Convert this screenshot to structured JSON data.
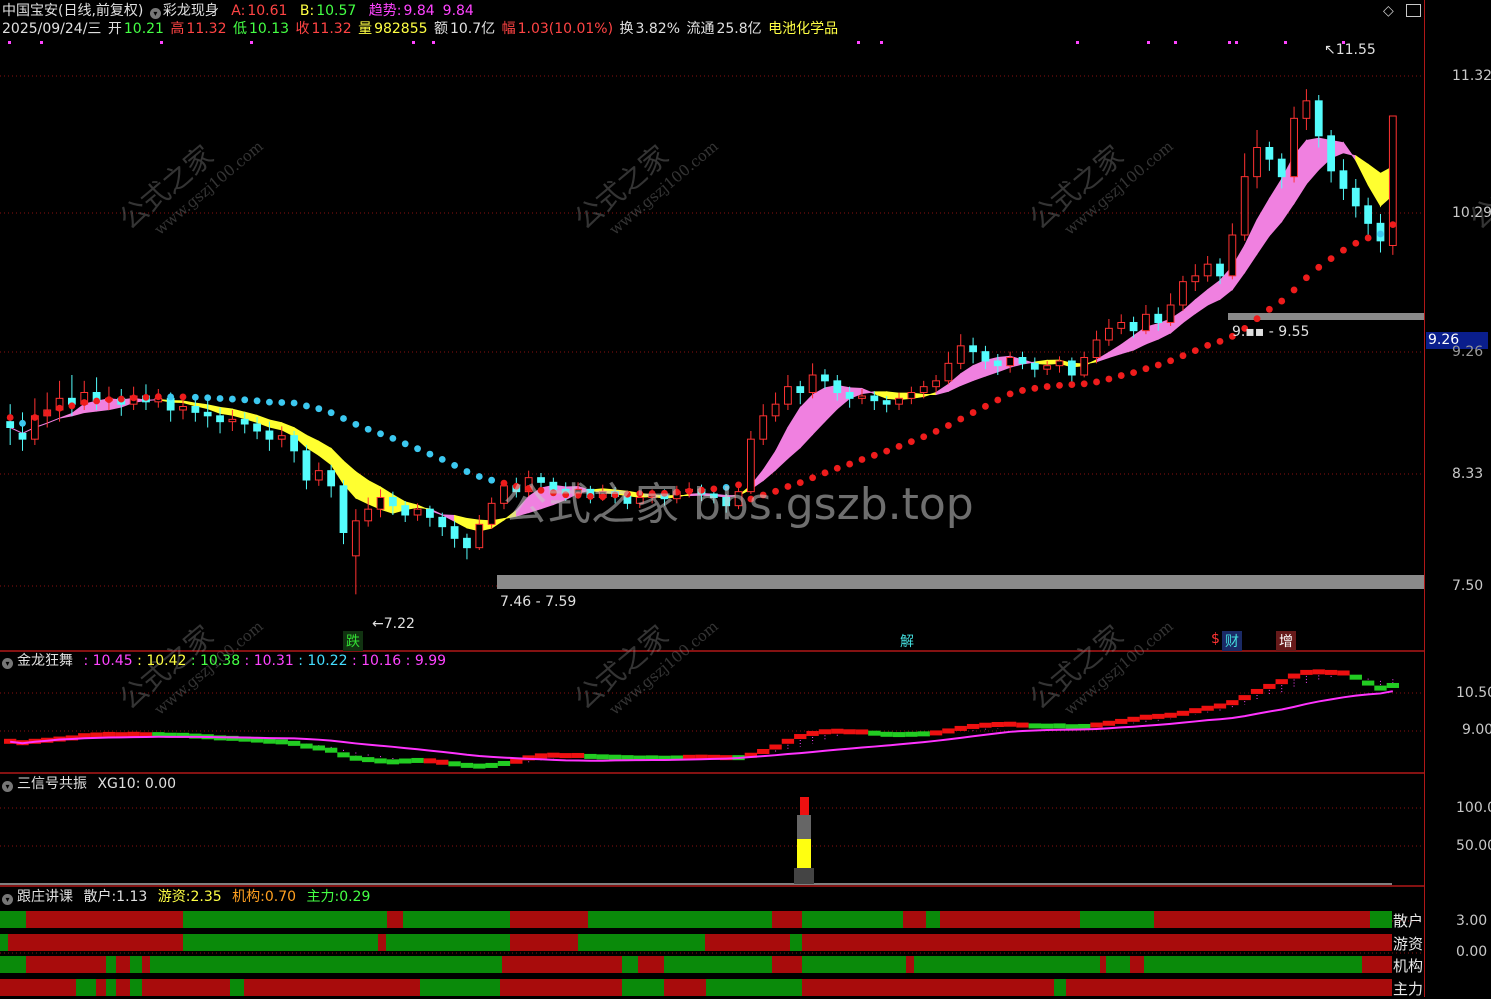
{
  "header": {
    "stock_name": "中国宝安(日线,前复权)",
    "indicator_name": "彩龙现身",
    "a_label": "A:",
    "a_value": "10.61",
    "b_label": "B:",
    "b_value": "10.57",
    "trend_label": "趋势:",
    "trend_value1": "9.84",
    "trend_value2": "9.84",
    "date": "2025/09/24/三",
    "open_label": "开",
    "open_value": "10.21",
    "high_label": "高",
    "high_value": "11.32",
    "low_label": "低",
    "low_value": "10.13",
    "close_label": "收",
    "close_value": "11.32",
    "volume_label": "量",
    "volume_value": "982855",
    "amount_label": "额",
    "amount_value": "10.7亿",
    "range_label": "幅",
    "range_value": "1.03(10.01%)",
    "turnover_label": "换",
    "turnover_value": "3.82%",
    "float_label": "流通",
    "float_value": "25.8亿",
    "sector": "电池化学品"
  },
  "main_chart": {
    "price_axis": [
      "11.32",
      "10.29",
      "9.26",
      "8.33",
      "7.50"
    ],
    "current_price_tag": "9.26",
    "annotations": {
      "high_mark": "11.55",
      "low_mark": "7.22",
      "zone_low": "7.46 - 7.59",
      "zone_high": "9.55",
      "zone_high_prefix": "9."
    },
    "signals": [
      {
        "text": "跌",
        "color": "#33dd33"
      },
      {
        "text": "解",
        "color": "#44dddd"
      },
      {
        "text": "$",
        "color": "#ff3333"
      },
      {
        "text": "财",
        "color": "#44dddd"
      },
      {
        "text": "增",
        "color": "#ffffff"
      }
    ],
    "watermark": "公式之家 bbs.gszb.top",
    "watermark_small_cn": "公式之家",
    "watermark_small_url": "www.gszj100.com"
  },
  "panel2": {
    "title": "金龙狂舞",
    "values": [
      {
        "text": "10.45",
        "color": "#ff44ff"
      },
      {
        "text": "10.42",
        "color": "#ffff44"
      },
      {
        "text": "10.38",
        "color": "#44ff44"
      },
      {
        "text": "10.31",
        "color": "#ff44ff"
      },
      {
        "text": "10.22",
        "color": "#44ddff"
      },
      {
        "text": "10.16",
        "color": "#ff44ff"
      },
      {
        "text": "9.99",
        "color": "#ff44ff"
      }
    ],
    "axis": [
      "10.50",
      "9.00"
    ]
  },
  "panel3": {
    "title": "三信号共振",
    "label": "XG10:",
    "value": "0.00",
    "axis": [
      "100.0",
      "50.00"
    ]
  },
  "panel4": {
    "title": "跟庄讲课",
    "items": [
      {
        "label": "散户:",
        "value": "1.13",
        "color": "#e0e0e0"
      },
      {
        "label": "游资:",
        "value": "2.35",
        "color": "#ffff44"
      },
      {
        "label": "机构:",
        "value": "0.70",
        "color": "#ffa020"
      },
      {
        "label": "主力:",
        "value": "0.29",
        "color": "#44ff44"
      }
    ],
    "axis": [
      "3.00",
      "0.00"
    ],
    "row_labels": [
      "散户",
      "游资",
      "机构",
      "主力"
    ]
  },
  "chart_data": {
    "type": "candlestick",
    "price_range": [
      7.0,
      11.8
    ],
    "candles": [
      [
        8.7,
        8.65,
        8.85,
        8.5
      ],
      [
        8.6,
        8.55,
        8.78,
        8.45
      ],
      [
        8.55,
        8.75,
        8.9,
        8.5
      ],
      [
        8.75,
        8.8,
        8.95,
        8.65
      ],
      [
        8.8,
        8.9,
        9.05,
        8.7
      ],
      [
        8.9,
        8.85,
        9.1,
        8.75
      ],
      [
        8.85,
        8.95,
        9.05,
        8.8
      ],
      [
        8.95,
        8.88,
        9.08,
        8.8
      ],
      [
        8.88,
        8.9,
        9.0,
        8.8
      ],
      [
        8.9,
        8.85,
        8.98,
        8.75
      ],
      [
        8.85,
        8.92,
        9.0,
        8.8
      ],
      [
        8.92,
        8.87,
        9.02,
        8.8
      ],
      [
        8.87,
        8.9,
        8.98,
        8.82
      ],
      [
        8.9,
        8.8,
        8.95,
        8.7
      ],
      [
        8.8,
        8.83,
        8.9,
        8.72
      ],
      [
        8.83,
        8.78,
        8.92,
        8.7
      ],
      [
        8.78,
        8.75,
        8.88,
        8.65
      ],
      [
        8.75,
        8.7,
        8.82,
        8.6
      ],
      [
        8.7,
        8.72,
        8.8,
        8.62
      ],
      [
        8.72,
        8.68,
        8.78,
        8.6
      ],
      [
        8.68,
        8.62,
        8.74,
        8.55
      ],
      [
        8.62,
        8.55,
        8.7,
        8.45
      ],
      [
        8.55,
        8.58,
        8.66,
        8.48
      ],
      [
        8.58,
        8.45,
        8.62,
        8.35
      ],
      [
        8.45,
        8.2,
        8.5,
        8.12
      ],
      [
        8.2,
        8.28,
        8.35,
        8.15
      ],
      [
        8.28,
        8.15,
        8.33,
        8.05
      ],
      [
        8.15,
        7.75,
        8.2,
        7.65
      ],
      [
        7.55,
        7.85,
        7.95,
        7.22
      ],
      [
        7.85,
        7.95,
        8.05,
        7.8
      ],
      [
        7.95,
        8.05,
        8.12,
        7.88
      ],
      [
        8.05,
        7.98,
        8.1,
        7.9
      ],
      [
        7.98,
        7.9,
        8.02,
        7.84
      ],
      [
        7.9,
        7.95,
        8.0,
        7.85
      ],
      [
        7.95,
        7.88,
        7.98,
        7.8
      ],
      [
        7.88,
        7.8,
        7.92,
        7.72
      ],
      [
        7.8,
        7.7,
        7.85,
        7.62
      ],
      [
        7.7,
        7.62,
        7.74,
        7.52
      ],
      [
        7.62,
        7.82,
        7.9,
        7.6
      ],
      [
        7.82,
        8.0,
        8.05,
        7.78
      ],
      [
        8.0,
        8.15,
        8.2,
        7.95
      ],
      [
        8.15,
        8.1,
        8.22,
        8.05
      ],
      [
        8.1,
        8.22,
        8.28,
        8.06
      ],
      [
        8.22,
        8.18,
        8.26,
        8.12
      ],
      [
        8.18,
        8.12,
        8.22,
        8.06
      ],
      [
        8.12,
        8.08,
        8.18,
        8.02
      ],
      [
        8.08,
        8.12,
        8.18,
        8.04
      ],
      [
        8.12,
        8.05,
        8.15,
        8.0
      ],
      [
        8.05,
        8.1,
        8.16,
        8.02
      ],
      [
        8.1,
        8.06,
        8.14,
        8.0
      ],
      [
        8.06,
        8.0,
        8.1,
        7.95
      ],
      [
        8.0,
        8.05,
        8.1,
        7.96
      ],
      [
        8.05,
        8.08,
        8.12,
        8.0
      ],
      [
        8.08,
        8.04,
        8.12,
        7.98
      ],
      [
        8.04,
        8.1,
        8.15,
        8.0
      ],
      [
        8.1,
        8.12,
        8.18,
        8.05
      ],
      [
        8.12,
        8.08,
        8.16,
        8.02
      ],
      [
        8.08,
        8.05,
        8.12,
        8.0
      ],
      [
        8.05,
        7.98,
        8.08,
        7.92
      ],
      [
        7.98,
        8.1,
        8.14,
        7.95
      ],
      [
        8.1,
        8.55,
        8.62,
        8.08
      ],
      [
        8.55,
        8.75,
        8.85,
        8.5
      ],
      [
        8.75,
        8.85,
        8.95,
        8.7
      ],
      [
        8.85,
        9.0,
        9.1,
        8.8
      ],
      [
        9.0,
        8.95,
        9.05,
        8.85
      ],
      [
        8.95,
        9.1,
        9.2,
        8.9
      ],
      [
        9.1,
        9.05,
        9.15,
        8.98
      ],
      [
        9.05,
        8.95,
        9.1,
        8.88
      ],
      [
        8.95,
        8.9,
        9.0,
        8.82
      ],
      [
        8.9,
        8.92,
        8.98,
        8.85
      ],
      [
        8.92,
        8.88,
        8.96,
        8.8
      ],
      [
        8.88,
        8.85,
        8.92,
        8.78
      ],
      [
        8.85,
        8.9,
        8.95,
        8.8
      ],
      [
        8.9,
        8.95,
        9.0,
        8.85
      ],
      [
        8.95,
        9.0,
        9.05,
        8.9
      ],
      [
        9.0,
        9.05,
        9.1,
        8.95
      ],
      [
        9.05,
        9.2,
        9.3,
        9.02
      ],
      [
        9.2,
        9.35,
        9.45,
        9.15
      ],
      [
        9.35,
        9.3,
        9.42,
        9.2
      ],
      [
        9.3,
        9.22,
        9.35,
        9.15
      ],
      [
        9.22,
        9.18,
        9.28,
        9.1
      ],
      [
        9.18,
        9.25,
        9.3,
        9.12
      ],
      [
        9.25,
        9.2,
        9.3,
        9.15
      ],
      [
        9.2,
        9.15,
        9.25,
        9.08
      ],
      [
        9.15,
        9.18,
        9.22,
        9.1
      ],
      [
        9.18,
        9.22,
        9.26,
        9.12
      ],
      [
        9.22,
        9.1,
        9.25,
        9.02
      ],
      [
        9.1,
        9.25,
        9.3,
        9.08
      ],
      [
        9.25,
        9.4,
        9.48,
        9.2
      ],
      [
        9.4,
        9.5,
        9.58,
        9.35
      ],
      [
        9.5,
        9.55,
        9.62,
        9.45
      ],
      [
        9.55,
        9.48,
        9.6,
        9.42
      ],
      [
        9.48,
        9.62,
        9.7,
        9.45
      ],
      [
        9.62,
        9.55,
        9.68,
        9.48
      ],
      [
        9.55,
        9.7,
        9.8,
        9.52
      ],
      [
        9.7,
        9.9,
        9.95,
        9.65
      ],
      [
        9.9,
        9.95,
        10.05,
        9.82
      ],
      [
        9.95,
        10.05,
        10.12,
        9.9
      ],
      [
        10.05,
        9.95,
        10.1,
        9.88
      ],
      [
        9.95,
        10.3,
        10.4,
        9.92
      ],
      [
        10.3,
        10.8,
        11.0,
        10.25
      ],
      [
        10.8,
        11.05,
        11.2,
        10.7
      ],
      [
        11.05,
        10.95,
        11.1,
        10.85
      ],
      [
        10.95,
        10.8,
        11.0,
        10.7
      ],
      [
        10.8,
        11.3,
        11.4,
        10.75
      ],
      [
        11.3,
        11.45,
        11.55,
        11.2
      ],
      [
        11.45,
        11.15,
        11.5,
        11.05
      ],
      [
        11.15,
        10.85,
        11.2,
        10.75
      ],
      [
        10.85,
        10.7,
        10.95,
        10.6
      ],
      [
        10.7,
        10.55,
        10.78,
        10.45
      ],
      [
        10.55,
        10.4,
        10.62,
        10.3
      ],
      [
        10.4,
        10.25,
        10.48,
        10.15
      ],
      [
        10.21,
        11.32,
        11.32,
        10.13
      ]
    ]
  }
}
